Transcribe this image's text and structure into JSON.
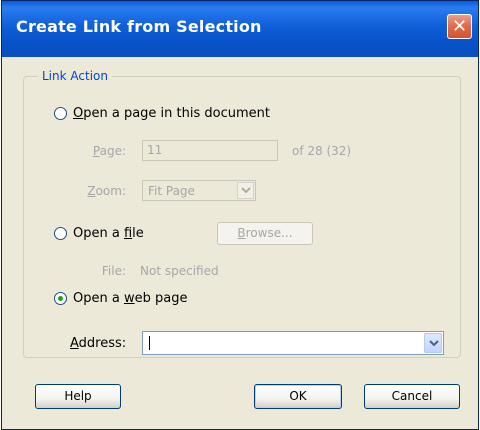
{
  "window": {
    "title": "Create Link from Selection",
    "close_glyph": "✕"
  },
  "group": {
    "label": "Link Action"
  },
  "options": {
    "page": {
      "label_first": "O",
      "label_rest": "pen a page in this document",
      "selected": false
    },
    "file": {
      "label_prefix": "Open a ",
      "label_underlined": "f",
      "label_suffix": "ile",
      "selected": false
    },
    "web": {
      "label_prefix": "Open a ",
      "label_underlined": "w",
      "label_suffix": "eb page",
      "selected": true
    }
  },
  "page_section": {
    "page_label_first": "P",
    "page_label_rest": "age:",
    "page_value": "11",
    "page_of": "of 28 (32)",
    "zoom_label_first": "Z",
    "zoom_label_rest": "oom:",
    "zoom_value": "Fit Page"
  },
  "file_section": {
    "browse_first": "B",
    "browse_rest": "rowse...",
    "file_label": "File:",
    "file_value": "Not specified"
  },
  "address": {
    "label_first": "A",
    "label_rest": "ddress:",
    "value": ""
  },
  "buttons": {
    "help": "Help",
    "ok": "OK",
    "cancel": "Cancel"
  }
}
